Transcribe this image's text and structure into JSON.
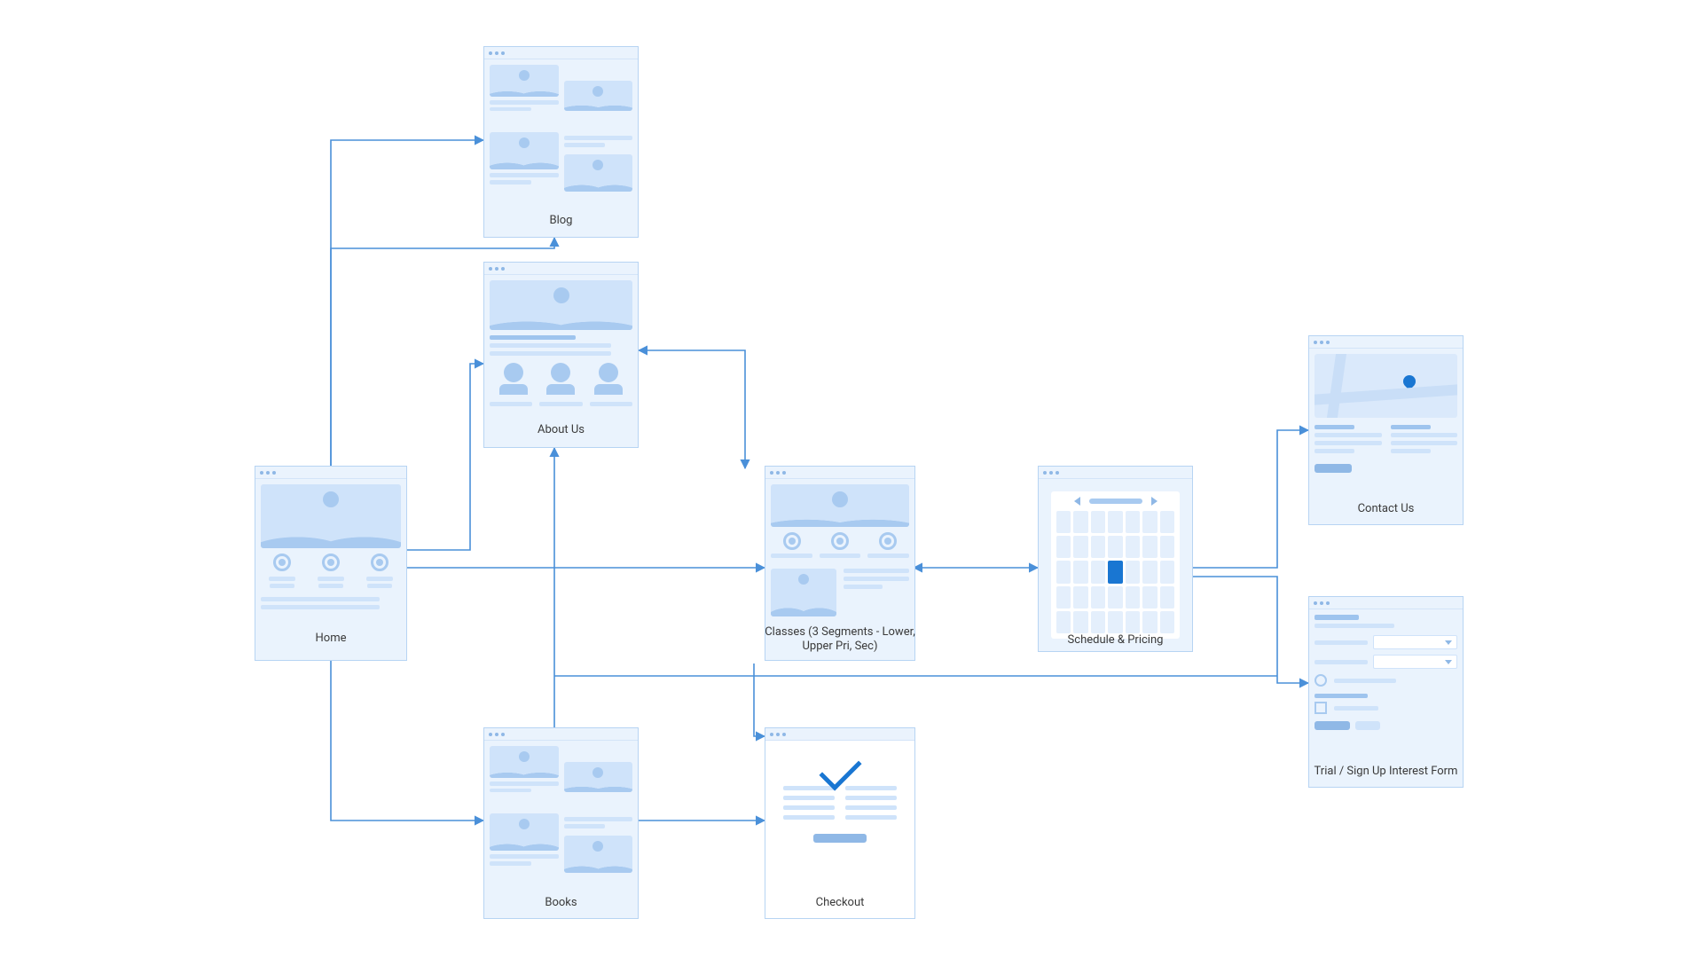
{
  "diagram": {
    "nodes": {
      "home": {
        "label": "Home"
      },
      "blog": {
        "label": "Blog"
      },
      "about": {
        "label": "About Us"
      },
      "classes": {
        "label": "Classes (3 Segments - Lower, Upper Pri, Sec)"
      },
      "schedule": {
        "label": "Schedule & Pricing"
      },
      "contact": {
        "label": "Contact Us"
      },
      "trial": {
        "label": "Trial / Sign Up Interest Form"
      },
      "books": {
        "label": "Books"
      },
      "checkout": {
        "label": "Checkout"
      }
    },
    "edges": [
      {
        "from": "home",
        "to": "blog",
        "bidirectional": true
      },
      {
        "from": "home",
        "to": "about",
        "bidirectional": false
      },
      {
        "from": "home",
        "to": "classes",
        "bidirectional": false
      },
      {
        "from": "home",
        "to": "books",
        "bidirectional": false
      },
      {
        "from": "about",
        "to": "classes",
        "bidirectional": true
      },
      {
        "from": "about",
        "to": "books",
        "bidirectional": false
      },
      {
        "from": "classes",
        "to": "schedule",
        "bidirectional": true
      },
      {
        "from": "classes",
        "to": "checkout",
        "bidirectional": false
      },
      {
        "from": "schedule",
        "to": "contact",
        "bidirectional": false
      },
      {
        "from": "schedule",
        "to": "trial",
        "bidirectional": false
      }
    ]
  },
  "colors": {
    "stroke": "#4a90d9",
    "fill_light": "#eaf3fd",
    "fill_mid": "#cfe3fa",
    "fill_dark": "#a8caf0",
    "accent": "#1976d2"
  }
}
